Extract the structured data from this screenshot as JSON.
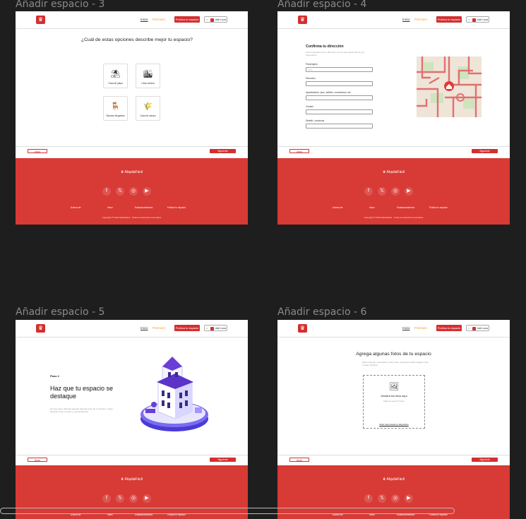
{
  "frames": {
    "f3": {
      "title": "Añadir espacio - 3"
    },
    "f4": {
      "title": "Añadir espacio - 4"
    },
    "f5": {
      "title": "Añadir espacio - 5"
    },
    "f6": {
      "title": "Añadir espacio - 6"
    }
  },
  "nav": {
    "inicio": "Inicio",
    "premium": "Premium",
    "publish": "Publica tu espacio",
    "menu_icon": "≡",
    "user": "Adri Luna"
  },
  "footer": {
    "brand": "AlquilaFácil",
    "icons": [
      "facebook-icon",
      "x-icon",
      "instagram-icon",
      "youtube-icon"
    ],
    "links": [
      "Acerca de",
      "Inbox",
      "Estacionamientos",
      "Publica tu espacio"
    ],
    "copyright": "Copyright © 2024 AlquilaFácil · Todos los derechos reservados"
  },
  "buttons": {
    "back": "Atrás",
    "next": "Siguiente"
  },
  "step3": {
    "question": "¿Cuál de estas opciones describe mejor tu espacio?",
    "options": [
      {
        "label": "Casa de playa",
        "icon": "umbrella-icon"
      },
      {
        "label": "Casa urbana",
        "icon": "city-icon"
      },
      {
        "label": "Salones elegantes",
        "icon": "armchair-icon"
      },
      {
        "label": "Casa de campo",
        "icon": "farm-icon"
      }
    ]
  },
  "step4": {
    "title": "Confirma tu dirección",
    "subtitle": "Solo compartiremos tu dirección con los que hayan hecho una reservación.",
    "fields": [
      {
        "label": "País/región",
        "value": "Perú"
      },
      {
        "label": "Dirección",
        "value": ""
      },
      {
        "label": "Apartamento, piso, edificio, condominio, etc",
        "value": ""
      },
      {
        "label": "Ciudad",
        "value": ""
      },
      {
        "label": "Distrito / provincia",
        "value": ""
      }
    ]
  },
  "step5": {
    "paso": "Paso 2",
    "title": "Haz que tu espacio se destaque",
    "desc": "En este paso, deberás agregar algunas fotos de tu espacio. Luego, deberás crear un título y una descripción."
  },
  "step6": {
    "title": "Agrega algunas fotos de tu espacio",
    "subtitle": "Para empezar, necesitarás cuatro fotos. Después podrás agregar más o hacer cambios.",
    "drop_title": "Arrastra tus fotos aquí",
    "drop_sub": "Elige al menos 5 fotos",
    "upload_link": "Subir fotos desde tu dispositivo"
  },
  "colors": {
    "brand": "#d32f2f",
    "footer": "#d83a35",
    "premium": "#f0a030"
  }
}
